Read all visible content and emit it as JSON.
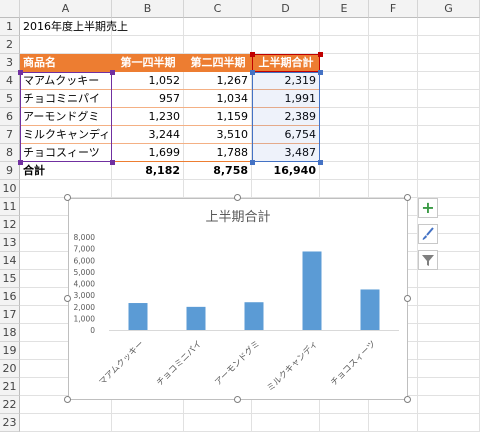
{
  "columns": [
    "A",
    "B",
    "C",
    "D",
    "E",
    "F",
    "G"
  ],
  "rows": [
    "1",
    "2",
    "3",
    "4",
    "5",
    "6",
    "7",
    "8",
    "9",
    "10",
    "11",
    "12",
    "13",
    "14",
    "15",
    "16",
    "17",
    "18",
    "19",
    "20",
    "21",
    "22",
    "23"
  ],
  "sheet": {
    "title": "2016年度上半期売上",
    "headers": [
      "商品名",
      "第一四半期",
      "第二四半期",
      "上半期合計"
    ],
    "products": [
      {
        "name": "マアムクッキー",
        "q1": "1,052",
        "q2": "1,267",
        "total": "2,319"
      },
      {
        "name": "チョコミニパイ",
        "q1": "957",
        "q2": "1,034",
        "total": "1,991"
      },
      {
        "name": "アーモンドグミ",
        "q1": "1,230",
        "q2": "1,159",
        "total": "2,389"
      },
      {
        "name": "ミルクキャンディ",
        "q1": "3,244",
        "q2": "3,510",
        "total": "6,754"
      },
      {
        "name": "チョコスィーツ",
        "q1": "1,699",
        "q2": "1,788",
        "total": "3,487"
      }
    ],
    "totals": {
      "label": "合計",
      "q1": "8,182",
      "q2": "8,758",
      "total": "16,940"
    }
  },
  "colors": {
    "header_fill": "#ed7d31",
    "bar": "#5b9bd5",
    "range_blue": "#4472c4",
    "range_purple": "#7030a0",
    "range_red": "#c00000"
  },
  "chart_data": {
    "type": "bar",
    "title": "上半期合計",
    "categories": [
      "マアムクッキー",
      "チョコミニパイ",
      "アーモンドグミ",
      "ミルクキャンディ",
      "チョコスィーツ"
    ],
    "values": [
      2319,
      1991,
      2389,
      6754,
      3487
    ],
    "yticks": [
      "0",
      "1,000",
      "2,000",
      "3,000",
      "4,000",
      "5,000",
      "6,000",
      "7,000",
      "8,000"
    ],
    "ylim": [
      0,
      8000
    ],
    "grid": false,
    "legend": "none"
  },
  "side_buttons": [
    {
      "icon": "plus-icon",
      "glyph": "+"
    },
    {
      "icon": "brush-icon",
      "glyph": "🖌"
    },
    {
      "icon": "filter-icon",
      "glyph": "⏷"
    }
  ]
}
